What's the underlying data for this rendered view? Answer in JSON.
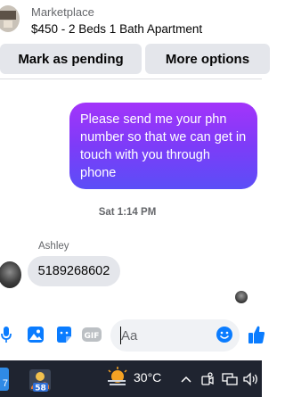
{
  "header": {
    "subtitle": "Marketplace",
    "title": "$450 - 2 Beds 1 Bath Apartment"
  },
  "actions": {
    "pending_label": "Mark as pending",
    "more_label": "More options"
  },
  "messages": {
    "outgoing_text": "Please send me your phn number so that we can get in touch with you through phone",
    "timestamp": "Sat 1:14 PM",
    "sender_name": "Ashley",
    "incoming_text": "5189268602"
  },
  "composer": {
    "placeholder": "Aa",
    "gif_label": "GIF"
  },
  "taskbar": {
    "left_badge": "7",
    "app_badge": "58",
    "temperature": "30°C"
  },
  "colors": {
    "bubble_out_top": "#a334fa",
    "bubble_out_bottom": "#5b4ef7",
    "bubble_in": "#e4e6eb",
    "accent": "#0a7cff",
    "taskbar": "#1f2430"
  },
  "icons": {
    "mic": "microphone-icon",
    "photo": "photo-icon",
    "sticker": "sticker-icon",
    "gif": "gif-icon",
    "emoji": "emoji-icon",
    "like": "thumbs-up-icon"
  }
}
